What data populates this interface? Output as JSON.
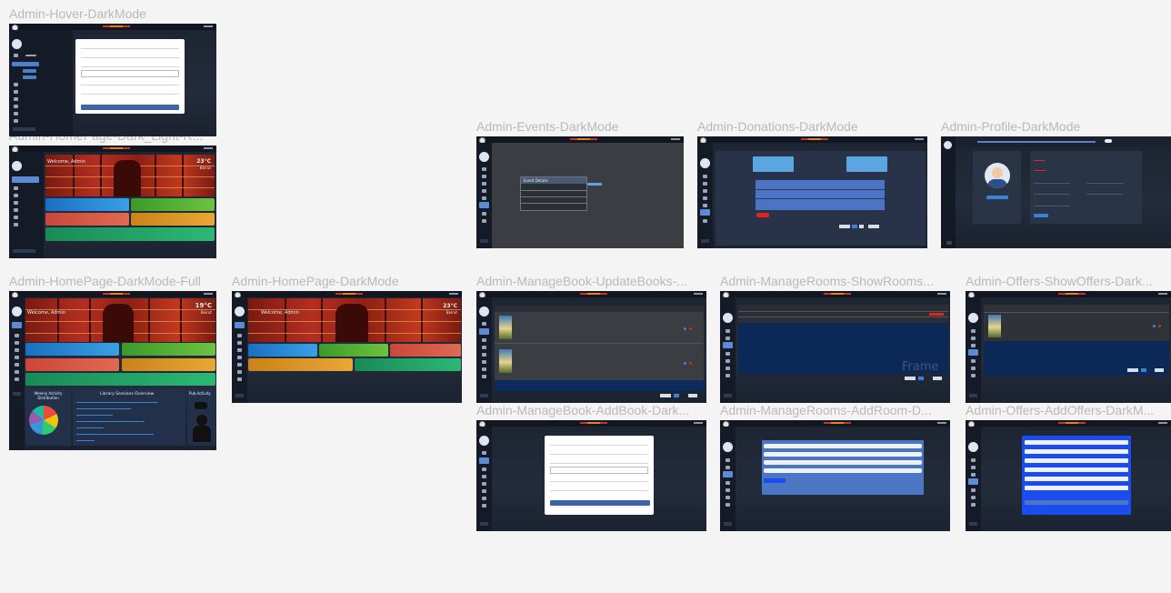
{
  "frames": [
    {
      "id": "hover",
      "label": "Admin-Hover-DarkMode"
    },
    {
      "id": "home-light",
      "label": "Admin-HomePage-Dark_Light-R..."
    },
    {
      "id": "home-full",
      "label": "Admin-HomePage-DarkMode-Full"
    },
    {
      "id": "home",
      "label": "Admin-HomePage-DarkMode"
    },
    {
      "id": "events",
      "label": "Admin-Events-DarkMode"
    },
    {
      "id": "donations",
      "label": "Admin-Donations-DarkMode"
    },
    {
      "id": "profile",
      "label": "Admin-Profile-DarkMode"
    },
    {
      "id": "update-books",
      "label": "Admin-ManageBook-UpdateBooks-..."
    },
    {
      "id": "show-rooms",
      "label": "Admin-ManageRooms-ShowRooms..."
    },
    {
      "id": "show-offers",
      "label": "Admin-Offers-ShowOffers-Dark..."
    },
    {
      "id": "add-book",
      "label": "Admin-ManageBook-AddBook-Dark..."
    },
    {
      "id": "add-room",
      "label": "Admin-ManageRooms-AddRoom-D..."
    },
    {
      "id": "add-offers",
      "label": "Admin-Offers-AddOffers-DarkM..."
    }
  ],
  "texts": {
    "welcome": "Welcome, Admin",
    "temp1": "23°C",
    "city1": "Beirut",
    "temp2": "19°C",
    "city2": "Beirut",
    "temp3": "23°C",
    "city3": "Beirut",
    "weekly": "Weekly Activity Distribution",
    "lib_overview": "Library Sessions Overview",
    "pub": "Pub.Activity",
    "event_details": "Event Details",
    "frame_text": "Frame"
  },
  "colors": {
    "canvas": "#f4f4f4",
    "frame_bg": "#1d2431",
    "accent_blue": "#3e64a8",
    "brand_red": "#c0392b"
  }
}
